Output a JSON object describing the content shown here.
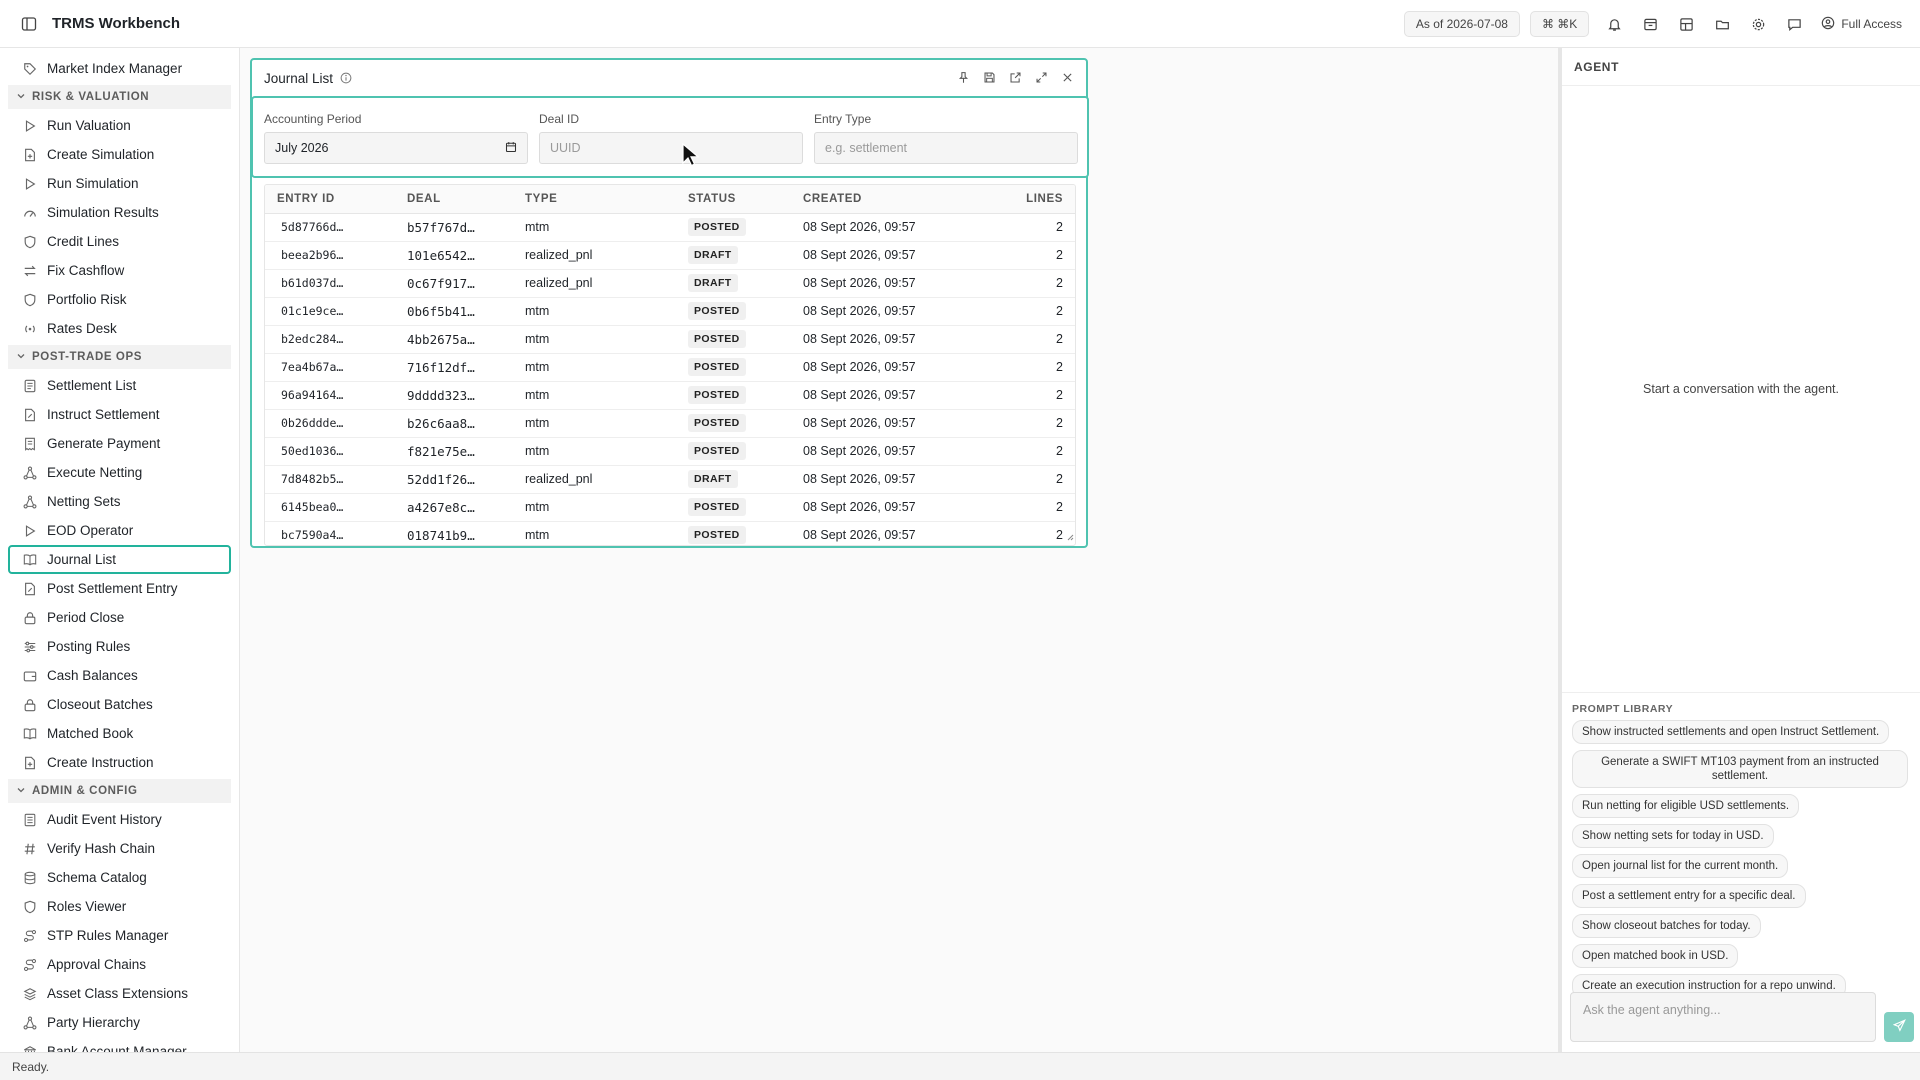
{
  "app": {
    "title": "TRMS Workbench"
  },
  "header": {
    "as_of": "As of 2026-07-08",
    "shortcut": "⌘ ⌘K",
    "access": "Full Access"
  },
  "sidebar": {
    "top_items": [
      {
        "label": "Market Index Manager",
        "icon": "tag-icon"
      }
    ],
    "sections": [
      {
        "title": "RISK & VALUATION",
        "items": [
          {
            "label": "Run Valuation",
            "icon": "play-icon"
          },
          {
            "label": "Create Simulation",
            "icon": "file-plus-icon"
          },
          {
            "label": "Run Simulation",
            "icon": "play-icon"
          },
          {
            "label": "Simulation Results",
            "icon": "gauge-icon"
          },
          {
            "label": "Credit Lines",
            "icon": "shield-icon"
          },
          {
            "label": "Fix Cashflow",
            "icon": "arrows-icon"
          },
          {
            "label": "Portfolio Risk",
            "icon": "shield-icon"
          },
          {
            "label": "Rates Desk",
            "icon": "radio-icon"
          }
        ]
      },
      {
        "title": "POST-TRADE OPS",
        "items": [
          {
            "label": "Settlement List",
            "icon": "list-icon"
          },
          {
            "label": "Instruct Settlement",
            "icon": "file-edit-icon"
          },
          {
            "label": "Generate Payment",
            "icon": "receipt-icon"
          },
          {
            "label": "Execute Netting",
            "icon": "network-icon"
          },
          {
            "label": "Netting Sets",
            "icon": "network-icon"
          },
          {
            "label": "EOD Operator",
            "icon": "play-icon"
          },
          {
            "label": "Journal List",
            "icon": "book-icon",
            "active": true
          },
          {
            "label": "Post Settlement Entry",
            "icon": "file-edit-icon"
          },
          {
            "label": "Period Close",
            "icon": "lock-icon"
          },
          {
            "label": "Posting Rules",
            "icon": "sliders-icon"
          },
          {
            "label": "Cash Balances",
            "icon": "wallet-icon"
          },
          {
            "label": "Closeout Batches",
            "icon": "lock-icon"
          },
          {
            "label": "Matched Book",
            "icon": "book-icon"
          },
          {
            "label": "Create Instruction",
            "icon": "file-plus-icon"
          }
        ]
      },
      {
        "title": "ADMIN & CONFIG",
        "items": [
          {
            "label": "Audit Event History",
            "icon": "history-icon"
          },
          {
            "label": "Verify Hash Chain",
            "icon": "hash-icon"
          },
          {
            "label": "Schema Catalog",
            "icon": "database-icon"
          },
          {
            "label": "Roles Viewer",
            "icon": "shield-icon"
          },
          {
            "label": "STP Rules Manager",
            "icon": "route-icon"
          },
          {
            "label": "Approval Chains",
            "icon": "route-icon"
          },
          {
            "label": "Asset Class Extensions",
            "icon": "layers-icon"
          },
          {
            "label": "Party Hierarchy",
            "icon": "network-icon"
          },
          {
            "label": "Bank Account Manager",
            "icon": "bank-icon"
          }
        ]
      }
    ]
  },
  "panel": {
    "title": "Journal List",
    "filters": {
      "period_label": "Accounting Period",
      "period_value": "July 2026",
      "deal_label": "Deal ID",
      "deal_placeholder": "UUID",
      "type_label": "Entry Type",
      "type_placeholder": "e.g. settlement"
    },
    "columns": [
      "ENTRY ID",
      "DEAL",
      "TYPE",
      "STATUS",
      "CREATED",
      "LINES"
    ],
    "rows": [
      [
        "5d87766d…",
        "b57f767d…",
        "mtm",
        "POSTED",
        "08 Sept 2026, 09:57",
        "2"
      ],
      [
        "beea2b96…",
        "101e6542…",
        "realized_pnl",
        "DRAFT",
        "08 Sept 2026, 09:57",
        "2"
      ],
      [
        "b61d037d…",
        "0c67f917…",
        "realized_pnl",
        "DRAFT",
        "08 Sept 2026, 09:57",
        "2"
      ],
      [
        "01c1e9ce…",
        "0b6f5b41…",
        "mtm",
        "POSTED",
        "08 Sept 2026, 09:57",
        "2"
      ],
      [
        "b2edc284…",
        "4bb2675a…",
        "mtm",
        "POSTED",
        "08 Sept 2026, 09:57",
        "2"
      ],
      [
        "7ea4b67a…",
        "716f12df…",
        "mtm",
        "POSTED",
        "08 Sept 2026, 09:57",
        "2"
      ],
      [
        "96a94164…",
        "9dddd323…",
        "mtm",
        "POSTED",
        "08 Sept 2026, 09:57",
        "2"
      ],
      [
        "0b26ddde…",
        "b26c6aa8…",
        "mtm",
        "POSTED",
        "08 Sept 2026, 09:57",
        "2"
      ],
      [
        "50ed1036…",
        "f821e75e…",
        "mtm",
        "POSTED",
        "08 Sept 2026, 09:57",
        "2"
      ],
      [
        "7d8482b5…",
        "52dd1f26…",
        "realized_pnl",
        "DRAFT",
        "08 Sept 2026, 09:57",
        "2"
      ],
      [
        "6145bea0…",
        "a4267e8c…",
        "mtm",
        "POSTED",
        "08 Sept 2026, 09:57",
        "2"
      ],
      [
        "bc7590a4…",
        "018741b9…",
        "mtm",
        "POSTED",
        "08 Sept 2026, 09:57",
        "2"
      ]
    ]
  },
  "agent": {
    "title": "AGENT",
    "empty_text": "Start a conversation with the agent.",
    "prompt_library_title": "PROMPT LIBRARY",
    "prompts": [
      "Show instructed settlements and open Instruct Settlement.",
      "Generate a SWIFT MT103 payment from an instructed settlement.",
      "Run netting for eligible USD settlements.",
      "Show netting sets for today in USD.",
      "Open journal list for the current month.",
      "Post a settlement entry for a specific deal.",
      "Show closeout batches for today.",
      "Open matched book in USD.",
      "Create an execution instruction for a repo unwind."
    ],
    "input_placeholder": "Ask the agent anything..."
  },
  "status": {
    "text": "Ready."
  },
  "colors": {
    "accent": "#22b39c",
    "panel_border": "#4fc3b0",
    "send": "#80cfc1"
  }
}
